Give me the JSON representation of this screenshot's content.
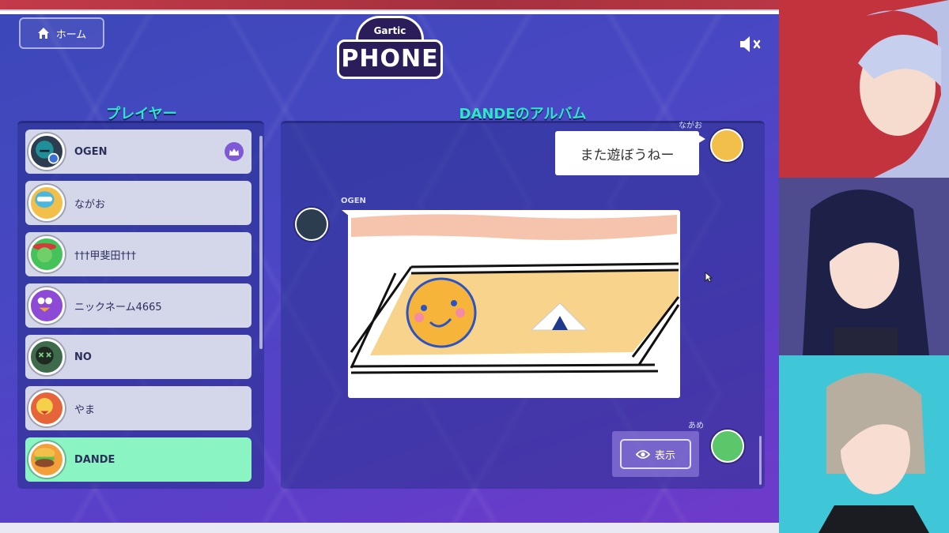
{
  "header": {
    "home_label": "ホーム",
    "logo_top": "Gartic",
    "logo_bottom": "PHONE"
  },
  "players": {
    "title": "プレイヤー",
    "items": [
      {
        "name": "OGEN",
        "host": true,
        "bold": true,
        "avatar_color": "#2b3d4f"
      },
      {
        "name": "ながお",
        "avatar_color": "#f2c04a"
      },
      {
        "name": "†††甲斐田†††",
        "avatar_color": "#46c25a"
      },
      {
        "name": "ニックネーム4665",
        "avatar_color": "#8d4ad6"
      },
      {
        "name": "NO",
        "bold": true,
        "avatar_color": "#3d6b4c"
      },
      {
        "name": "やま",
        "avatar_color": "#e6643a"
      },
      {
        "name": "DANDE",
        "bold": true,
        "active": true,
        "avatar_color": "#f3a03a"
      }
    ]
  },
  "album": {
    "title": "DANDEのアルバム",
    "entries": [
      {
        "author": "ながお",
        "type": "text",
        "text": "また遊ぼうねー"
      },
      {
        "author": "OGEN",
        "type": "drawing"
      },
      {
        "author": "あめ",
        "type": "hidden",
        "button_label": "表示"
      }
    ]
  },
  "colors": {
    "accent_title": "#2de7c9",
    "active_player": "#8af5c2",
    "crown_badge": "#7f58d6"
  }
}
